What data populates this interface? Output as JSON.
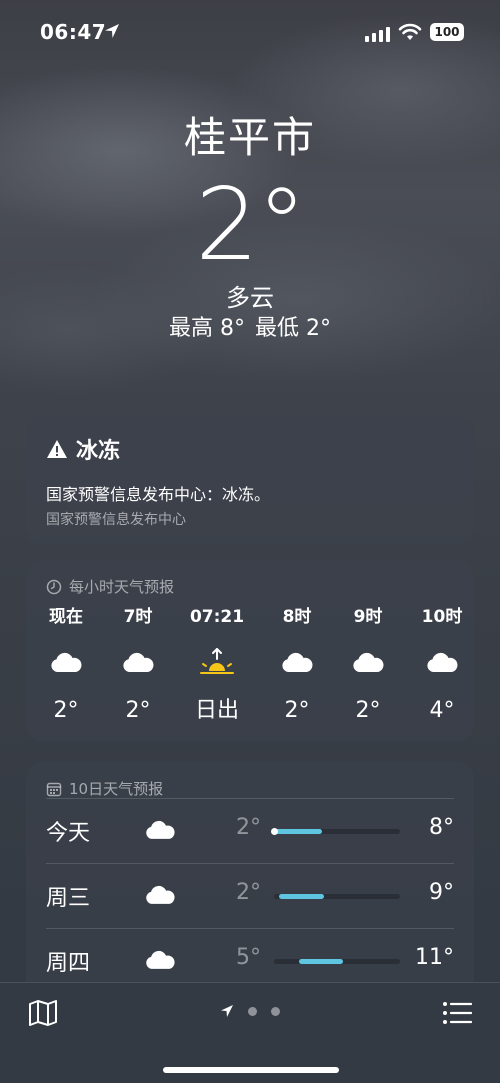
{
  "status": {
    "time": "06:47",
    "battery": "100"
  },
  "location": {
    "city": "桂平市",
    "temp": "2°",
    "condition": "多云",
    "high": "最高 8°",
    "low": "最低 2°"
  },
  "alert": {
    "title": "冰冻",
    "text": "国家预警信息发布中心：冰冻。",
    "source": "国家预警信息发布中心"
  },
  "hourly": {
    "header": "每小时天气预报",
    "items": [
      {
        "label": "现在",
        "icon": "cloud-icon",
        "value": "2°"
      },
      {
        "label": "7时",
        "icon": "cloud-icon",
        "value": "2°"
      },
      {
        "label": "07:21",
        "icon": "sunrise-icon",
        "value": "日出"
      },
      {
        "label": "8时",
        "icon": "cloud-icon",
        "value": "2°"
      },
      {
        "label": "9时",
        "icon": "cloud-icon",
        "value": "2°"
      },
      {
        "label": "10时",
        "icon": "cloud-icon",
        "value": "4°"
      }
    ]
  },
  "daily": {
    "header": "10日天气预报",
    "items": [
      {
        "day": "今天",
        "icon": "cloud-icon",
        "low": "2°",
        "high": "8°",
        "range_start": 0.0,
        "range_end": 0.38,
        "current": true
      },
      {
        "day": "周三",
        "icon": "cloud-icon",
        "low": "2°",
        "high": "9°",
        "range_start": 0.04,
        "range_end": 0.4,
        "current": false
      },
      {
        "day": "周四",
        "icon": "cloud-icon",
        "low": "5°",
        "high": "11°",
        "range_start": 0.2,
        "range_end": 0.55,
        "current": false
      }
    ]
  },
  "colors": {
    "range_bar": "#5ec6e0",
    "sun": "#f5c518"
  }
}
